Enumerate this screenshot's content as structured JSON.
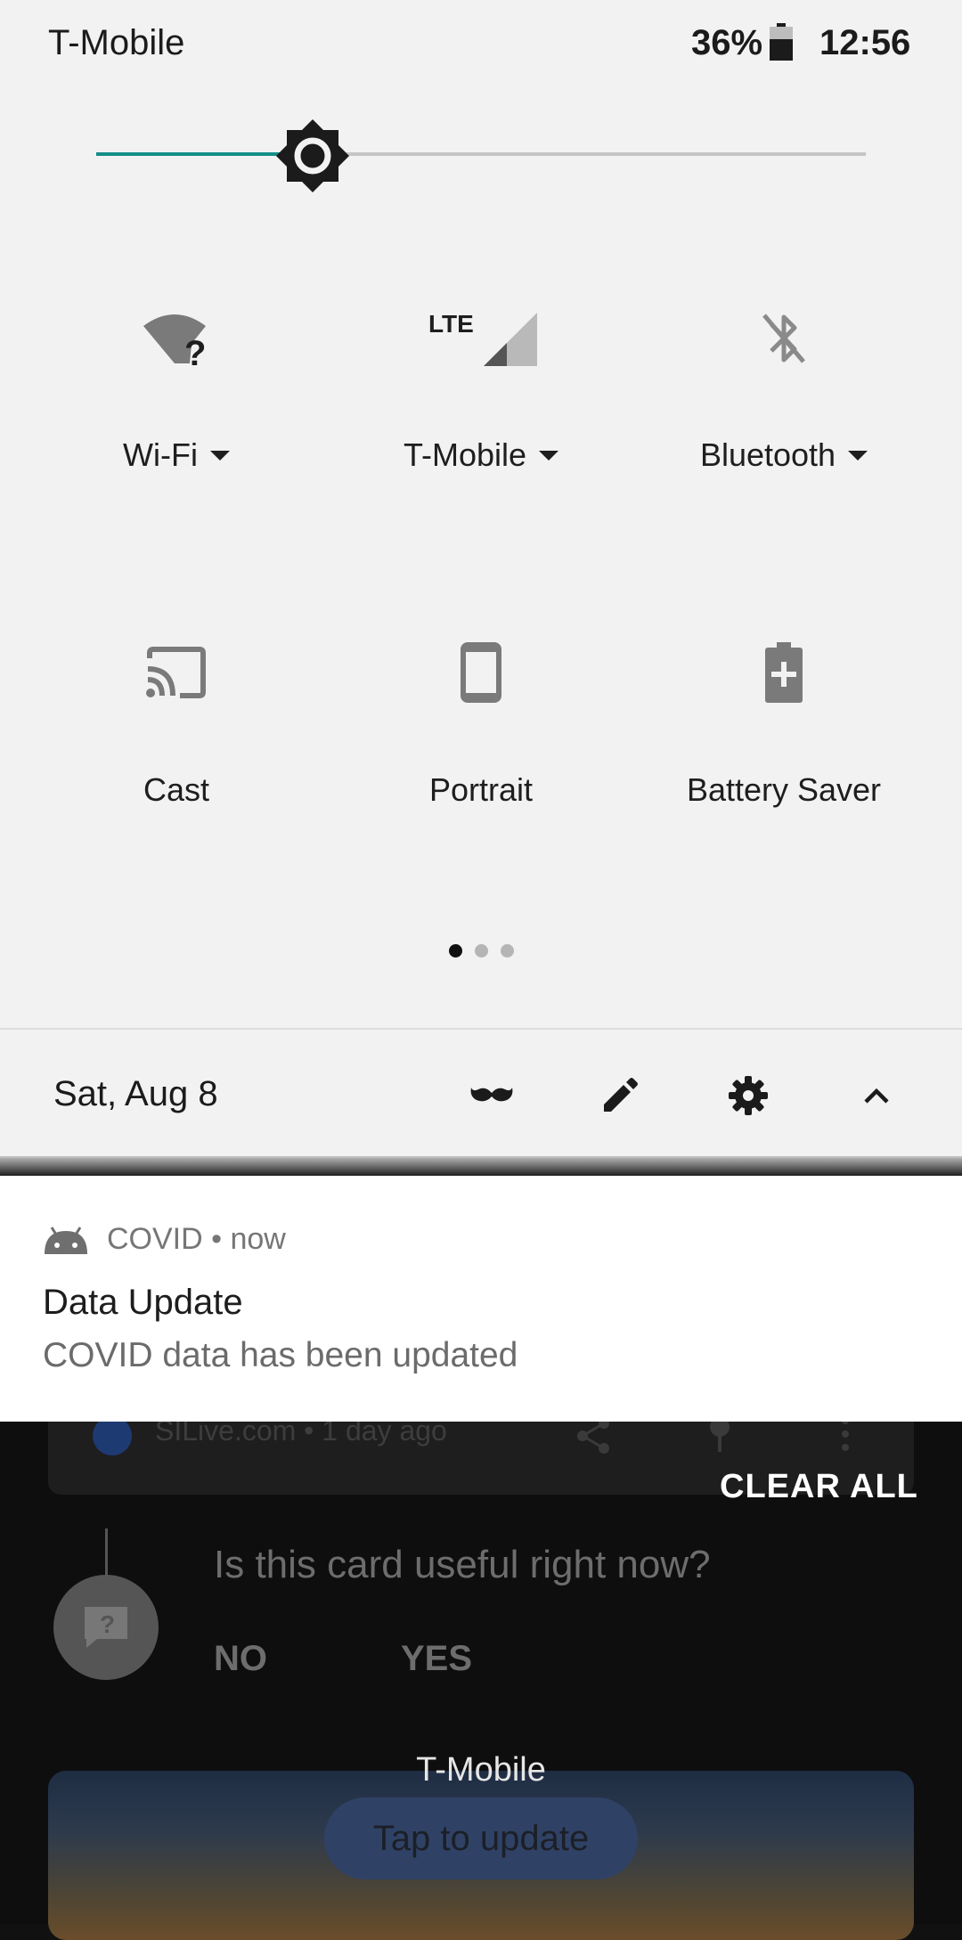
{
  "status_bar": {
    "carrier": "T-Mobile",
    "battery_percent": "36%",
    "battery_level": 0.36,
    "time": "12:56",
    "battery_icon": "battery-icon"
  },
  "brightness": {
    "level": 0.28,
    "icon": "brightness-icon",
    "accent": "#148e87"
  },
  "tiles": [
    {
      "label": "Wi-Fi",
      "icon": "wifi-question-icon",
      "has_dropdown": true
    },
    {
      "label": "T-Mobile",
      "icon": "lte-signal-icon",
      "icon_text": "LTE",
      "has_dropdown": true
    },
    {
      "label": "Bluetooth",
      "icon": "bluetooth-off-icon",
      "has_dropdown": true
    },
    {
      "label": "Cast",
      "icon": "cast-icon",
      "has_dropdown": false
    },
    {
      "label": "Portrait",
      "icon": "portrait-phone-icon",
      "has_dropdown": false
    },
    {
      "label": "Battery Saver",
      "icon": "battery-saver-icon",
      "has_dropdown": false
    }
  ],
  "pager": {
    "pages": 3,
    "current": 1
  },
  "footer": {
    "date": "Sat, Aug 8",
    "icons": [
      "mustache-icon",
      "edit-pencil-icon",
      "settings-gear-icon",
      "collapse-chevron-icon"
    ]
  },
  "notification": {
    "app_name": "COVID",
    "time": "now",
    "header": "COVID • now",
    "title": "Data Update",
    "text": "COVID data has been updated",
    "app_icon": "android-icon"
  },
  "background": {
    "card_source": "SILive.com • 1 day ago",
    "clear_all": "CLEAR ALL",
    "feedback_question": "Is this card useful right now?",
    "feedback_no": "NO",
    "feedback_yes": "YES",
    "lock_carrier": "T-Mobile",
    "tap_to_update": "Tap to update"
  }
}
